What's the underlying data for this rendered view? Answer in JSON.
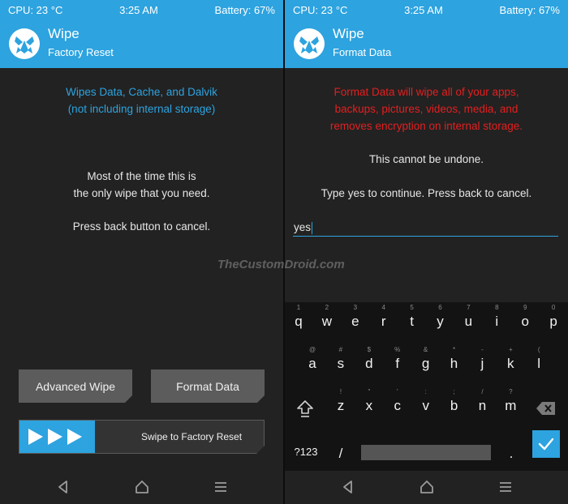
{
  "watermark": "TheCustomDroid.com",
  "colors": {
    "accent": "#2da3df",
    "warning": "#e41f1f",
    "background": "#222222"
  },
  "left": {
    "status": {
      "cpu": "CPU: 23 °C",
      "time": "3:25 AM",
      "battery": "Battery: 67%"
    },
    "header": {
      "title": "Wipe",
      "subtitle": "Factory Reset"
    },
    "info": {
      "line1": "Wipes Data, Cache, and Dalvik",
      "line2": "(not including internal storage)"
    },
    "message": {
      "line1": "Most of the time this is",
      "line2": "the only wipe that you need.",
      "line3": "Press back button to cancel."
    },
    "buttons": {
      "advanced": "Advanced Wipe",
      "format": "Format Data"
    },
    "swipe": {
      "label": "Swipe to Factory Reset"
    }
  },
  "right": {
    "status": {
      "cpu": "CPU: 23 °C",
      "time": "3:25 AM",
      "battery": "Battery: 67%"
    },
    "header": {
      "title": "Wipe",
      "subtitle": "Format Data"
    },
    "warning": {
      "line1": "Format Data will wipe all of your apps,",
      "line2": "backups, pictures, videos, media, and",
      "line3": "removes encryption on internal storage."
    },
    "undone": "This cannot be undone.",
    "prompt": "Type yes to continue.  Press back to cancel.",
    "input_value": "yes",
    "keyboard": {
      "row1": [
        {
          "hint": "1",
          "key": "q"
        },
        {
          "hint": "2",
          "key": "w"
        },
        {
          "hint": "3",
          "key": "e"
        },
        {
          "hint": "4",
          "key": "r"
        },
        {
          "hint": "5",
          "key": "t"
        },
        {
          "hint": "6",
          "key": "y"
        },
        {
          "hint": "7",
          "key": "u"
        },
        {
          "hint": "8",
          "key": "i"
        },
        {
          "hint": "9",
          "key": "o"
        },
        {
          "hint": "0",
          "key": "p"
        }
      ],
      "row2": [
        {
          "hint": "@",
          "key": "a"
        },
        {
          "hint": "#",
          "key": "s"
        },
        {
          "hint": "$",
          "key": "d"
        },
        {
          "hint": "%",
          "key": "f"
        },
        {
          "hint": "&",
          "key": "g"
        },
        {
          "hint": "*",
          "key": "h"
        },
        {
          "hint": "-",
          "key": "j"
        },
        {
          "hint": "+",
          "key": "k"
        },
        {
          "hint": "(",
          "key": "l"
        }
      ],
      "row3": [
        {
          "hint": "!",
          "key": "z"
        },
        {
          "hint": "\"",
          "key": "x"
        },
        {
          "hint": "'",
          "key": "c"
        },
        {
          "hint": ":",
          "key": "v"
        },
        {
          "hint": ";",
          "key": "b"
        },
        {
          "hint": "/",
          "key": "n"
        },
        {
          "hint": "?",
          "key": "m"
        }
      ],
      "symbols_label": "?123",
      "slash": "/",
      "period": "."
    }
  }
}
